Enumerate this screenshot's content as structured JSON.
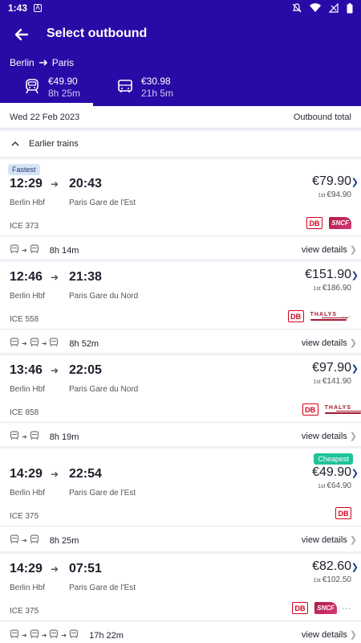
{
  "status": {
    "time": "1:43"
  },
  "header": {
    "title": "Select outbound",
    "from": "Berlin",
    "to": "Paris"
  },
  "modes": [
    {
      "price": "€49.90",
      "duration": "8h 25m",
      "icon": "train-icon",
      "active": true
    },
    {
      "price": "€30.98",
      "duration": "21h 5m",
      "icon": "bus-icon",
      "active": false
    }
  ],
  "datebar": {
    "date": "Wed 22 Feb 2023",
    "right": "Outbound total"
  },
  "earlier": {
    "label": "Earlier trains"
  },
  "trains": [
    {
      "badge": "Fastest",
      "dep": "12:29",
      "arr": "20:43",
      "dep_station": "Berlin Hbf",
      "arr_station": "Paris Gare de l'Est",
      "price": "€79.90",
      "first_label": "1st",
      "first": "€94.90",
      "train": "ICE 373",
      "duration": "8h 14m",
      "details": "view details",
      "operators": [
        "DB",
        "SNCF"
      ],
      "legs": 2
    },
    {
      "badge": "",
      "dep": "12:46",
      "arr": "21:38",
      "dep_station": "Berlin Hbf",
      "arr_station": "Paris Gare du Nord",
      "price": "€151.90",
      "first_label": "1st",
      "first": "€186.90",
      "train": "ICE 558",
      "duration": "8h 52m",
      "details": "view details",
      "operators": [
        "DB",
        "THALYS"
      ],
      "legs": 3
    },
    {
      "badge": "",
      "dep": "13:46",
      "arr": "22:05",
      "dep_station": "Berlin Hbf",
      "arr_station": "Paris Gare du Nord",
      "price": "€97.90",
      "first_label": "1st",
      "first": "€141.90",
      "train": "ICE 858",
      "duration": "8h 19m",
      "details": "view details",
      "operators": [
        "DB",
        "THALYS"
      ],
      "legs": 2
    },
    {
      "badge": "Cheapest",
      "dep": "14:29",
      "arr": "22:54",
      "dep_station": "Berlin Hbf",
      "arr_station": "Paris Gare de l'Est",
      "price": "€49.90",
      "first_label": "1st",
      "first": "€64.90",
      "train": "ICE 375",
      "duration": "8h 25m",
      "details": "view details",
      "operators": [
        "DB"
      ],
      "legs": 2
    },
    {
      "badge": "",
      "dep": "14:29",
      "arr": "07:51",
      "dep_station": "Berlin Hbf",
      "arr_station": "Paris Gare de l'Est",
      "price": "€82.60",
      "first_label": "1st",
      "first": "€102.50",
      "train": "ICE 375",
      "duration": "17h 22m",
      "details": "view details",
      "operators": [
        "DB",
        "SNCF"
      ],
      "legs": 4
    }
  ],
  "colors": {
    "header": "#2a0aa6",
    "fastest_badge": "#d6e3f7",
    "cheapest_badge": "#1fc29a",
    "db_red": "#d7011c"
  }
}
